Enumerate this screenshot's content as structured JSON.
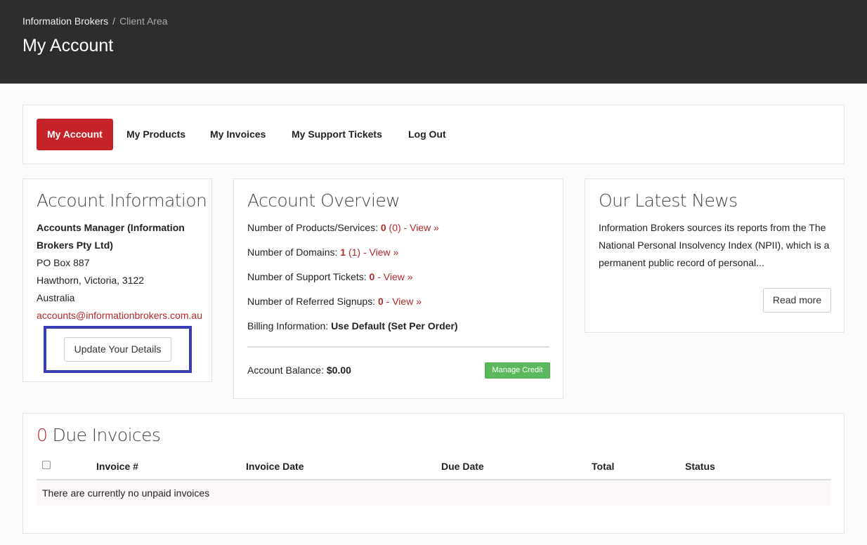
{
  "header": {
    "breadcrumb": {
      "home": "Information Brokers",
      "separator": "/",
      "current": "Client Area"
    },
    "title": "My Account"
  },
  "nav": {
    "items": [
      {
        "label": "My Account",
        "active": true
      },
      {
        "label": "My Products"
      },
      {
        "label": "My Invoices"
      },
      {
        "label": "My Support Tickets"
      },
      {
        "label": "Log Out"
      }
    ]
  },
  "account_info": {
    "title": "Account Information",
    "name_line1": "Accounts Manager (Information",
    "name_line2": "Brokers Pty Ltd)",
    "address1": "PO Box 887",
    "address2": "Hawthorn, Victoria, 3122",
    "country": "Australia",
    "email": "accounts@informationbrokers.com.au",
    "update_button": "Update Your Details"
  },
  "overview": {
    "title": "Account Overview",
    "products": {
      "label": "Number of Products/Services:",
      "count": "0",
      "sub": "(0)",
      "link": "- View »"
    },
    "domains": {
      "label": "Number of Domains:",
      "count": "1",
      "sub": "(1)",
      "link": "- View »"
    },
    "tickets": {
      "label": "Number of Support Tickets:",
      "count": "0",
      "link": "- View »"
    },
    "referred": {
      "label": "Number of Referred Signups:",
      "count": "0",
      "link": "- View »"
    },
    "billing": {
      "label": "Billing Information:",
      "value": "Use Default (Set Per Order)"
    },
    "balance": {
      "label": "Account Balance:",
      "value": "$0.00"
    },
    "manage_credit": "Manage Credit"
  },
  "news": {
    "title": "Our Latest News",
    "line1": "Information Brokers sources its reports from the The",
    "line2": "National Personal Insolvency Index (NPII), which is a",
    "line3": "permanent public record of personal...",
    "read_more": "Read more"
  },
  "invoices": {
    "count": "0",
    "title": "Due Invoices",
    "columns": [
      "Invoice #",
      "Invoice Date",
      "Due Date",
      "Total",
      "Status"
    ],
    "empty_message": "There are currently no unpaid invoices"
  },
  "colors": {
    "accent": "#c62229",
    "header_bg": "#2d2d2b",
    "highlight": "#3a3cb8",
    "success": "#5cb85c"
  }
}
